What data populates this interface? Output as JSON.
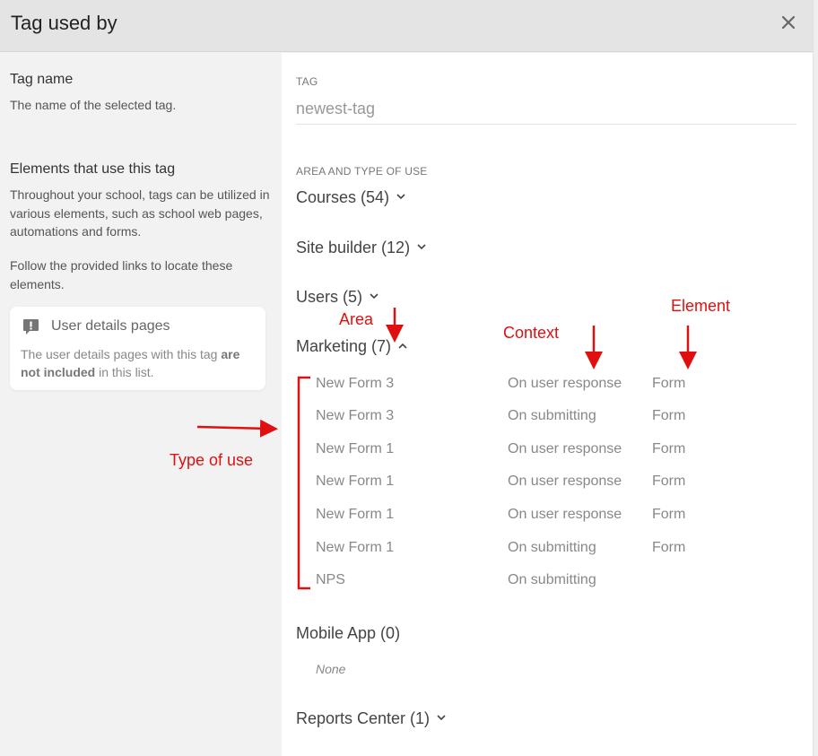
{
  "header": {
    "title": "Tag used by",
    "close_label": "✕"
  },
  "sidebar": {
    "tag_name_heading": "Tag name",
    "tag_name_desc": "The name of the selected tag.",
    "elements_heading": "Elements that use this tag",
    "elements_desc": "Throughout your school, tags can be utilized in various elements, such as school web pages, automations and forms.",
    "follow_desc": "Follow the provided links to locate these elements.",
    "note": {
      "title": "User details pages",
      "text_before": "The user details pages with this tag ",
      "text_bold": "are not included",
      "text_after": " in this list."
    }
  },
  "main": {
    "tag_label": "TAG",
    "tag_value": "newest-tag",
    "area_label": "AREA AND TYPE OF USE",
    "sections": {
      "courses": "Courses (54)",
      "site_builder": "Site builder (12)",
      "users": "Users (5)",
      "marketing": "Marketing (7)",
      "mobile_app": "Mobile App (0)",
      "reports_center": "Reports Center (1)"
    },
    "marketing_rows": [
      {
        "type": "New Form 3",
        "context": "On user response",
        "element": "Form"
      },
      {
        "type": "New Form 3",
        "context": "On submitting",
        "element": "Form"
      },
      {
        "type": "New Form 1",
        "context": "On user response",
        "element": "Form"
      },
      {
        "type": "New Form 1",
        "context": "On user response",
        "element": "Form"
      },
      {
        "type": "New Form 1",
        "context": "On user response",
        "element": "Form"
      },
      {
        "type": "New Form 1",
        "context": "On submitting",
        "element": "Form"
      },
      {
        "type": "NPS",
        "context": "On submitting",
        "element": ""
      }
    ],
    "mobile_app_empty": "None"
  },
  "annotations": {
    "area": "Area",
    "context": "Context",
    "element": "Element",
    "type_of_use": "Type of use",
    "color": "#e01010"
  },
  "icons": {
    "close": "close-icon",
    "chevron_down": "chevron-down-icon",
    "chevron_up": "chevron-up-icon",
    "note": "exclamation-icon"
  }
}
